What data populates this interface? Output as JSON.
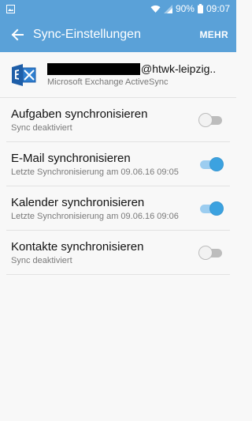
{
  "colors": {
    "accent": "#5aa1d8",
    "switch_on": "#3ca2e0",
    "switch_off": "#bdbdbd"
  },
  "status_bar": {
    "battery": "90%",
    "time": "09:07"
  },
  "app_bar": {
    "title": "Sync-Einstellungen",
    "more_label": "MEHR"
  },
  "account": {
    "email_domain": "@htwk-leipzig..",
    "type": "Microsoft Exchange ActiveSync",
    "icon": "exchange-icon"
  },
  "sync_items": [
    {
      "title": "Aufgaben synchronisieren",
      "subtitle": "Sync deaktiviert",
      "enabled": false
    },
    {
      "title": "E-Mail synchronisieren",
      "subtitle": "Letzte Synchronisierung am 09.06.16 09:05",
      "enabled": true
    },
    {
      "title": "Kalender synchronisieren",
      "subtitle": "Letzte Synchronisierung am 09.06.16 09:06",
      "enabled": true
    },
    {
      "title": "Kontakte synchronisieren",
      "subtitle": "Sync deaktiviert",
      "enabled": false
    }
  ]
}
